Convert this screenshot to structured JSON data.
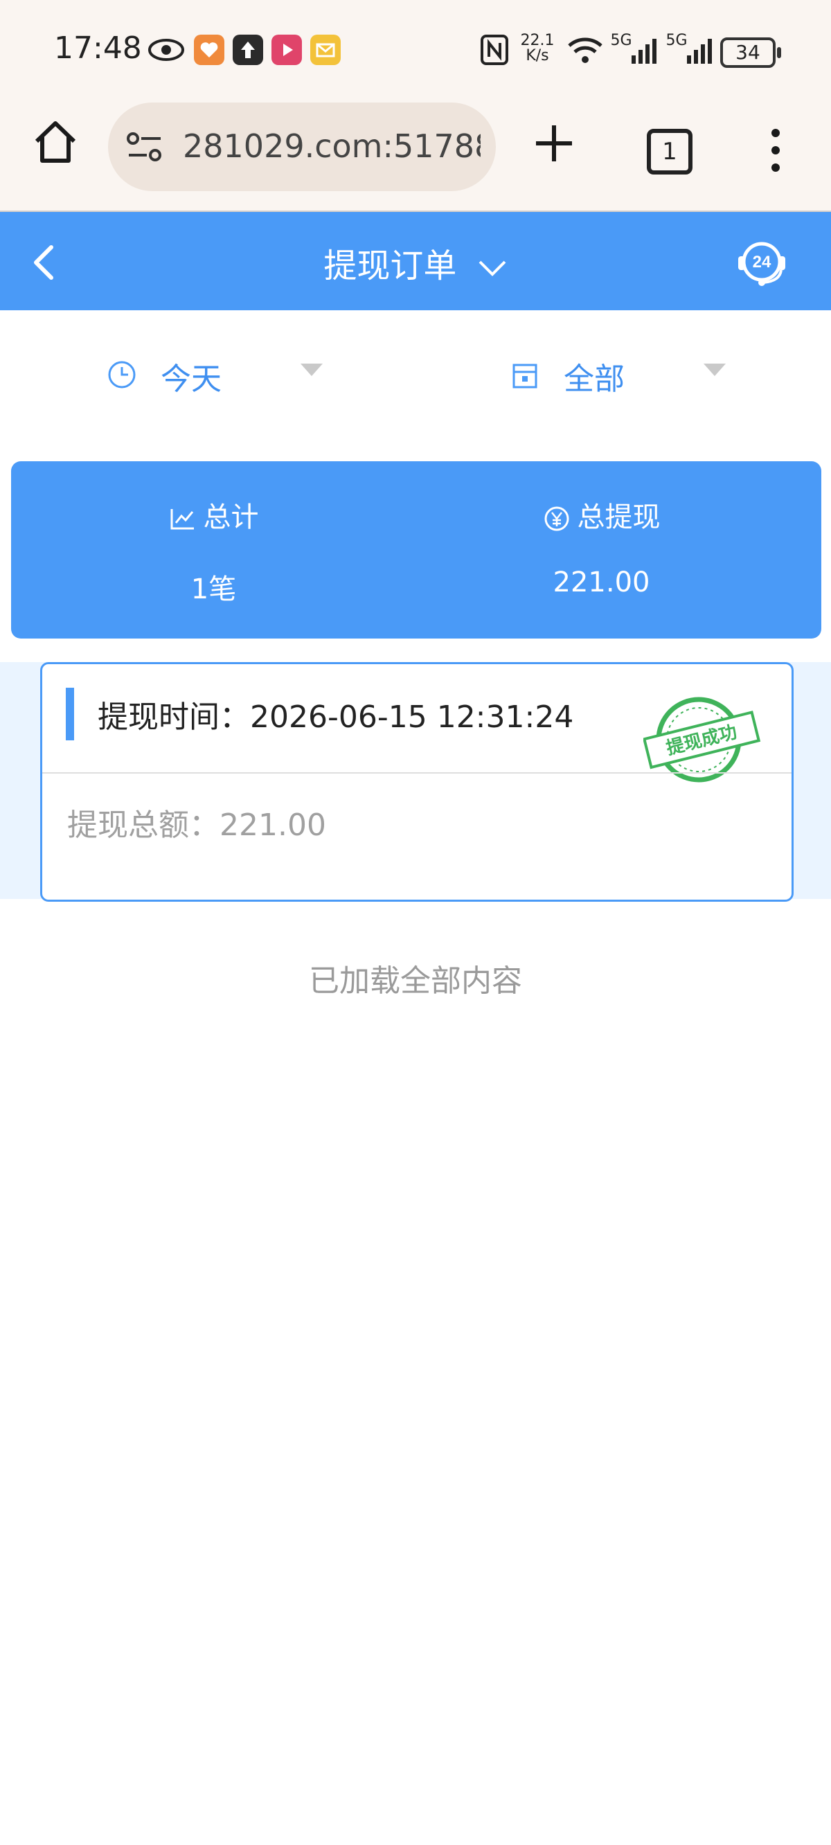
{
  "status_bar": {
    "time": "17:48",
    "net_speed_value": "22.1",
    "net_speed_unit": "K/s",
    "signal1": "5G",
    "signal2": "5G",
    "battery": "34"
  },
  "browser": {
    "url": "281029.com:51788",
    "tab_count": "1"
  },
  "header": {
    "title": "提现订单",
    "support_badge": "24"
  },
  "filters": {
    "date_label": "今天",
    "status_label": "全部"
  },
  "summary": {
    "total_label": "总计",
    "total_value": "1笔",
    "withdraw_label": "总提现",
    "withdraw_value": "221.00"
  },
  "orders": [
    {
      "time_label": "提现时间：",
      "time_value": "2026-06-15 12:31:24",
      "amount_label": "提现总额：",
      "amount_value": "221.00",
      "stamp_text": "提现成功"
    }
  ],
  "footer": {
    "loaded_text": "已加载全部内容"
  },
  "colors": {
    "accent": "#4a9af7",
    "chrome_bg": "#faf5f1",
    "stamp_green": "#3fb35a"
  }
}
